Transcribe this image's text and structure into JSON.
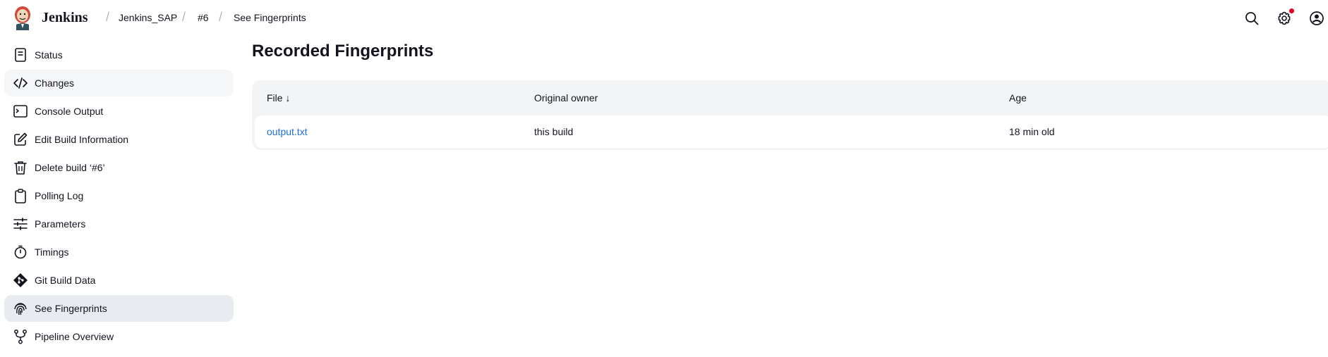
{
  "header": {
    "brand": "Jenkins",
    "breadcrumbs": [
      "Jenkins_SAP",
      "#6",
      "See Fingerprints"
    ],
    "separator": "/",
    "icons": [
      "search-icon",
      "settings-icon",
      "user-icon"
    ],
    "notification_color": "#e6001f"
  },
  "sidebar": {
    "items": [
      {
        "label": "Status",
        "icon": "status-icon"
      },
      {
        "label": "Changes",
        "icon": "code-icon"
      },
      {
        "label": "Console Output",
        "icon": "terminal-icon"
      },
      {
        "label": "Edit Build Information",
        "icon": "edit-icon"
      },
      {
        "label": "Delete build ‘#6’",
        "icon": "trash-icon"
      },
      {
        "label": "Polling Log",
        "icon": "clipboard-icon"
      },
      {
        "label": "Parameters",
        "icon": "sliders-icon"
      },
      {
        "label": "Timings",
        "icon": "stopwatch-icon"
      },
      {
        "label": "Git Build Data",
        "icon": "git-icon"
      },
      {
        "label": "See Fingerprints",
        "icon": "fingerprint-icon"
      },
      {
        "label": "Pipeline Overview",
        "icon": "pipeline-icon"
      }
    ],
    "active_index": 9,
    "hover_index": 1
  },
  "main": {
    "title": "Recorded Fingerprints",
    "table": {
      "columns": [
        "File  ↓",
        "Original owner",
        "Age"
      ],
      "rows": [
        {
          "file": "output.txt",
          "owner": "this build",
          "age": "18 min old"
        }
      ]
    }
  },
  "colors": {
    "link": "#1c6ed1",
    "active_bg": "#e8ebf0",
    "table_bg": "#f2f4f6"
  }
}
